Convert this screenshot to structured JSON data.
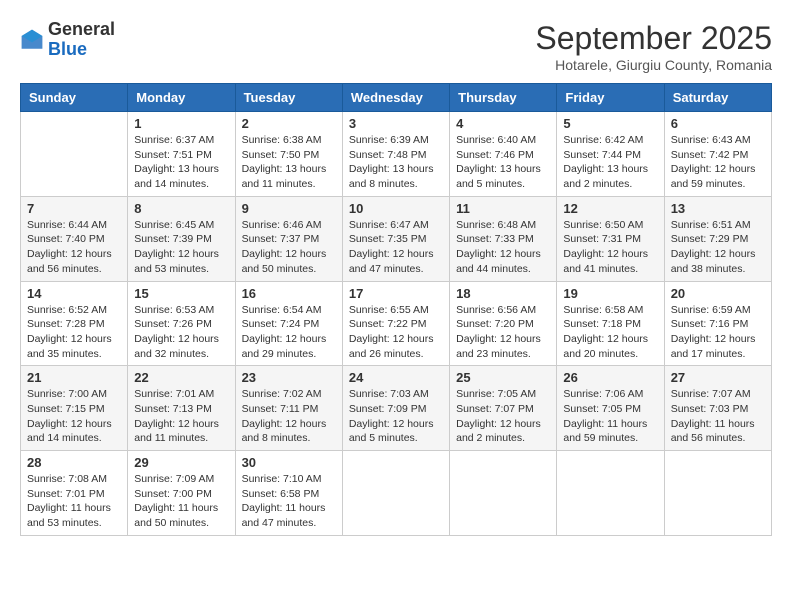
{
  "logo": {
    "general": "General",
    "blue": "Blue"
  },
  "title": "September 2025",
  "subtitle": "Hotarele, Giurgiu County, Romania",
  "weekdays": [
    "Sunday",
    "Monday",
    "Tuesday",
    "Wednesday",
    "Thursday",
    "Friday",
    "Saturday"
  ],
  "weeks": [
    [
      {
        "day": "",
        "info": ""
      },
      {
        "day": "1",
        "info": "Sunrise: 6:37 AM\nSunset: 7:51 PM\nDaylight: 13 hours\nand 14 minutes."
      },
      {
        "day": "2",
        "info": "Sunrise: 6:38 AM\nSunset: 7:50 PM\nDaylight: 13 hours\nand 11 minutes."
      },
      {
        "day": "3",
        "info": "Sunrise: 6:39 AM\nSunset: 7:48 PM\nDaylight: 13 hours\nand 8 minutes."
      },
      {
        "day": "4",
        "info": "Sunrise: 6:40 AM\nSunset: 7:46 PM\nDaylight: 13 hours\nand 5 minutes."
      },
      {
        "day": "5",
        "info": "Sunrise: 6:42 AM\nSunset: 7:44 PM\nDaylight: 13 hours\nand 2 minutes."
      },
      {
        "day": "6",
        "info": "Sunrise: 6:43 AM\nSunset: 7:42 PM\nDaylight: 12 hours\nand 59 minutes."
      }
    ],
    [
      {
        "day": "7",
        "info": "Sunrise: 6:44 AM\nSunset: 7:40 PM\nDaylight: 12 hours\nand 56 minutes."
      },
      {
        "day": "8",
        "info": "Sunrise: 6:45 AM\nSunset: 7:39 PM\nDaylight: 12 hours\nand 53 minutes."
      },
      {
        "day": "9",
        "info": "Sunrise: 6:46 AM\nSunset: 7:37 PM\nDaylight: 12 hours\nand 50 minutes."
      },
      {
        "day": "10",
        "info": "Sunrise: 6:47 AM\nSunset: 7:35 PM\nDaylight: 12 hours\nand 47 minutes."
      },
      {
        "day": "11",
        "info": "Sunrise: 6:48 AM\nSunset: 7:33 PM\nDaylight: 12 hours\nand 44 minutes."
      },
      {
        "day": "12",
        "info": "Sunrise: 6:50 AM\nSunset: 7:31 PM\nDaylight: 12 hours\nand 41 minutes."
      },
      {
        "day": "13",
        "info": "Sunrise: 6:51 AM\nSunset: 7:29 PM\nDaylight: 12 hours\nand 38 minutes."
      }
    ],
    [
      {
        "day": "14",
        "info": "Sunrise: 6:52 AM\nSunset: 7:28 PM\nDaylight: 12 hours\nand 35 minutes."
      },
      {
        "day": "15",
        "info": "Sunrise: 6:53 AM\nSunset: 7:26 PM\nDaylight: 12 hours\nand 32 minutes."
      },
      {
        "day": "16",
        "info": "Sunrise: 6:54 AM\nSunset: 7:24 PM\nDaylight: 12 hours\nand 29 minutes."
      },
      {
        "day": "17",
        "info": "Sunrise: 6:55 AM\nSunset: 7:22 PM\nDaylight: 12 hours\nand 26 minutes."
      },
      {
        "day": "18",
        "info": "Sunrise: 6:56 AM\nSunset: 7:20 PM\nDaylight: 12 hours\nand 23 minutes."
      },
      {
        "day": "19",
        "info": "Sunrise: 6:58 AM\nSunset: 7:18 PM\nDaylight: 12 hours\nand 20 minutes."
      },
      {
        "day": "20",
        "info": "Sunrise: 6:59 AM\nSunset: 7:16 PM\nDaylight: 12 hours\nand 17 minutes."
      }
    ],
    [
      {
        "day": "21",
        "info": "Sunrise: 7:00 AM\nSunset: 7:15 PM\nDaylight: 12 hours\nand 14 minutes."
      },
      {
        "day": "22",
        "info": "Sunrise: 7:01 AM\nSunset: 7:13 PM\nDaylight: 12 hours\nand 11 minutes."
      },
      {
        "day": "23",
        "info": "Sunrise: 7:02 AM\nSunset: 7:11 PM\nDaylight: 12 hours\nand 8 minutes."
      },
      {
        "day": "24",
        "info": "Sunrise: 7:03 AM\nSunset: 7:09 PM\nDaylight: 12 hours\nand 5 minutes."
      },
      {
        "day": "25",
        "info": "Sunrise: 7:05 AM\nSunset: 7:07 PM\nDaylight: 12 hours\nand 2 minutes."
      },
      {
        "day": "26",
        "info": "Sunrise: 7:06 AM\nSunset: 7:05 PM\nDaylight: 11 hours\nand 59 minutes."
      },
      {
        "day": "27",
        "info": "Sunrise: 7:07 AM\nSunset: 7:03 PM\nDaylight: 11 hours\nand 56 minutes."
      }
    ],
    [
      {
        "day": "28",
        "info": "Sunrise: 7:08 AM\nSunset: 7:01 PM\nDaylight: 11 hours\nand 53 minutes."
      },
      {
        "day": "29",
        "info": "Sunrise: 7:09 AM\nSunset: 7:00 PM\nDaylight: 11 hours\nand 50 minutes."
      },
      {
        "day": "30",
        "info": "Sunrise: 7:10 AM\nSunset: 6:58 PM\nDaylight: 11 hours\nand 47 minutes."
      },
      {
        "day": "",
        "info": ""
      },
      {
        "day": "",
        "info": ""
      },
      {
        "day": "",
        "info": ""
      },
      {
        "day": "",
        "info": ""
      }
    ]
  ]
}
